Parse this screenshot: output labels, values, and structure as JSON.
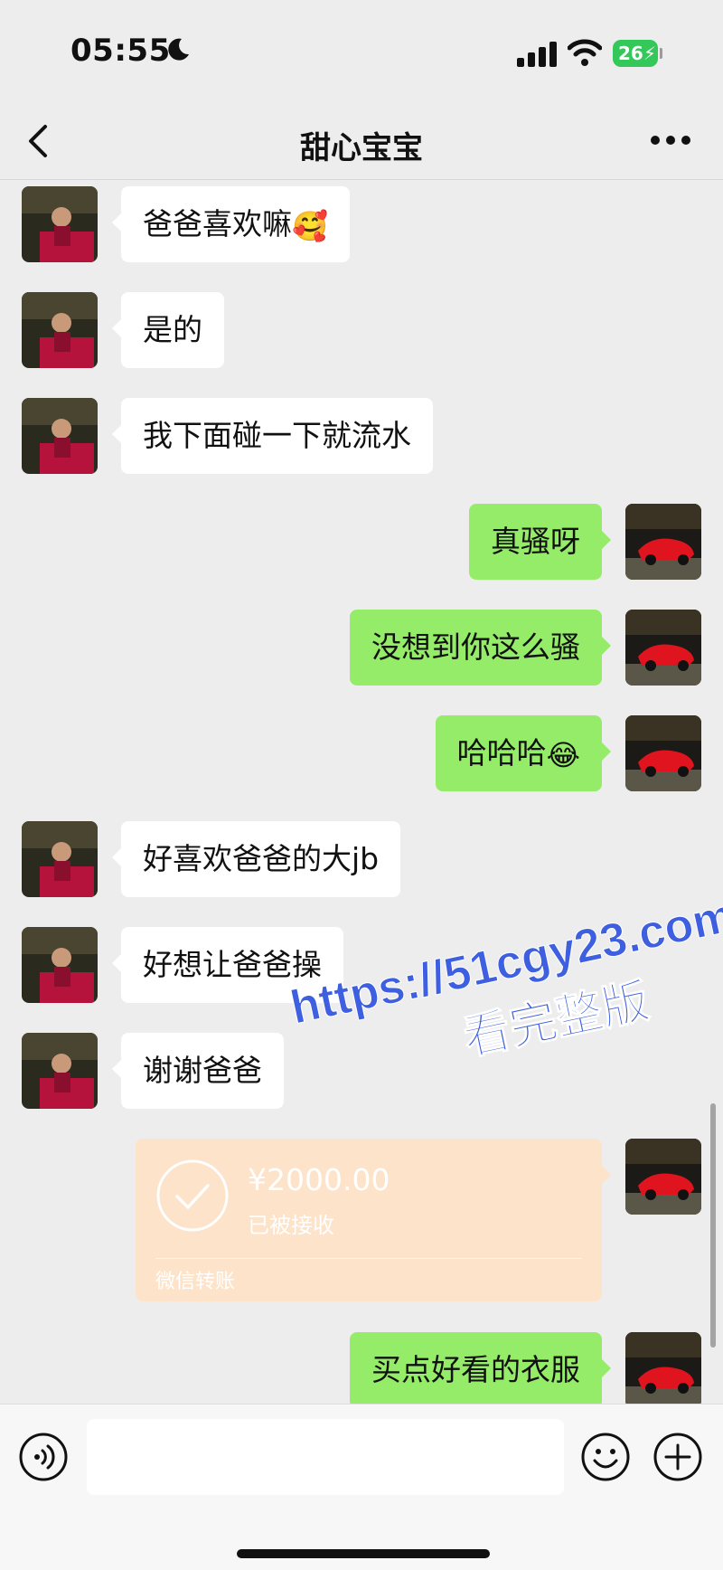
{
  "status_bar": {
    "time": "05:55",
    "battery_level": "26",
    "icons": [
      "moon-icon",
      "signal-icon",
      "wifi-icon",
      "battery-icon"
    ]
  },
  "nav": {
    "title": "甜心宝宝",
    "back_icon": "chevron-left-icon",
    "more_icon": "more-icon"
  },
  "messages": [
    {
      "side": "in",
      "text": "爸爸喜欢嘛",
      "emoji": "🥰"
    },
    {
      "side": "in",
      "text": "是的"
    },
    {
      "side": "in",
      "text": "我下面碰一下就流水"
    },
    {
      "side": "out",
      "text": "真骚呀"
    },
    {
      "side": "out",
      "text": "没想到你这么骚"
    },
    {
      "side": "out",
      "text": "哈哈哈",
      "emoji": "😂"
    },
    {
      "side": "in",
      "text": "好喜欢爸爸的大jb"
    },
    {
      "side": "in",
      "text": "好想让爸爸操"
    },
    {
      "side": "in",
      "text": "谢谢爸爸"
    },
    {
      "side": "out",
      "type": "transfer",
      "amount": "¥2000.00",
      "status": "已被接收",
      "label": "微信转账"
    },
    {
      "side": "out",
      "text": "买点好看的衣服"
    }
  ],
  "watermark": {
    "line1": "https://51cgy23.com",
    "line2": "看完整版"
  },
  "input_bar": {
    "value": "",
    "voice_icon": "voice-icon",
    "emoji_icon": "emoji-icon",
    "plus_icon": "plus-icon"
  },
  "colors": {
    "background": "#ededed",
    "incoming_bubble": "#ffffff",
    "outgoing_bubble": "#95ec69",
    "transfer_card": "#fde3c9",
    "watermark": "#3d5fe0",
    "battery": "#34c759"
  }
}
